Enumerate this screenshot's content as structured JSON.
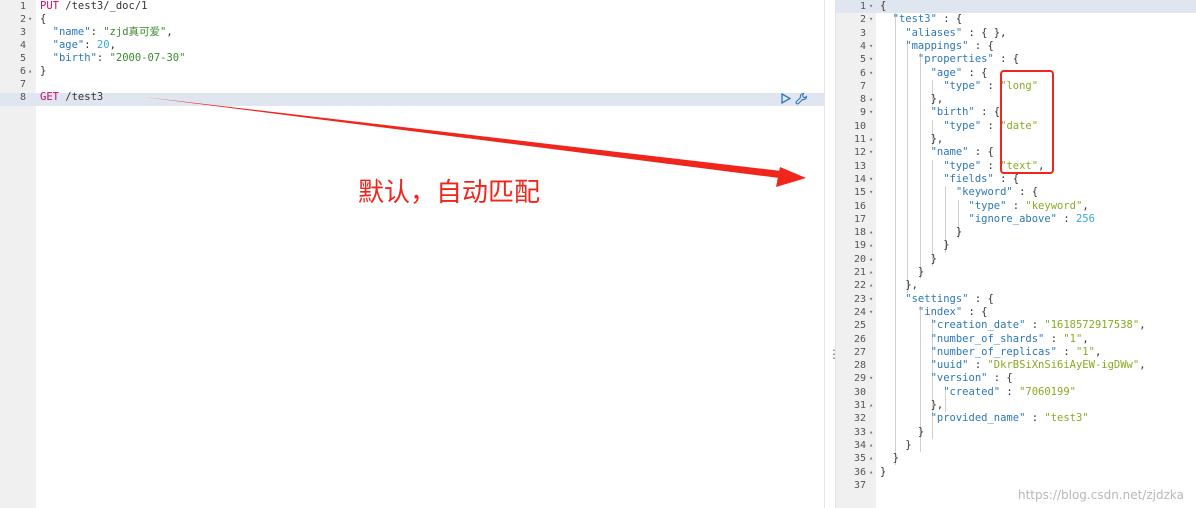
{
  "colors": {
    "method": "#c80a68",
    "key": "#2d77b6",
    "string": "#88aa22",
    "number": "#3da5d9",
    "annotation": "#f0251c",
    "active_line": "#e0e6ef",
    "gutter": "#f0f0f0"
  },
  "request_editor": {
    "lines": [
      {
        "n": "1",
        "fold": "",
        "tokens": [
          {
            "t": "PUT",
            "c": "method"
          },
          {
            "t": " /test3/_doc/1",
            "c": "url"
          }
        ]
      },
      {
        "n": "2",
        "fold": "▾",
        "tokens": [
          {
            "t": "{",
            "c": "punc"
          }
        ]
      },
      {
        "n": "3",
        "fold": "",
        "tokens": [
          {
            "t": "  \"name\"",
            "c": "key"
          },
          {
            "t": ": ",
            "c": "punc"
          },
          {
            "t": "\"zjd真可爱\"",
            "c": "strg"
          },
          {
            "t": ",",
            "c": "punc"
          }
        ]
      },
      {
        "n": "4",
        "fold": "",
        "tokens": [
          {
            "t": "  \"age\"",
            "c": "key"
          },
          {
            "t": ": ",
            "c": "punc"
          },
          {
            "t": "20",
            "c": "num"
          },
          {
            "t": ",",
            "c": "punc"
          }
        ]
      },
      {
        "n": "5",
        "fold": "",
        "tokens": [
          {
            "t": "  \"birth\"",
            "c": "key"
          },
          {
            "t": ": ",
            "c": "punc"
          },
          {
            "t": "\"2000-07-30\"",
            "c": "strg"
          }
        ]
      },
      {
        "n": "6",
        "fold": "▴",
        "tokens": [
          {
            "t": "}",
            "c": "punc"
          }
        ]
      },
      {
        "n": "7",
        "fold": "",
        "tokens": []
      },
      {
        "n": "8",
        "fold": "",
        "tokens": [
          {
            "t": "GET",
            "c": "method"
          },
          {
            "t": " /test3",
            "c": "url"
          }
        ]
      }
    ],
    "run_icon": "play-icon",
    "settings_icon": "wrench-icon"
  },
  "response_viewer": {
    "lines": [
      {
        "n": "1",
        "fold": "▾",
        "tokens": [
          {
            "t": "{",
            "c": "punc"
          }
        ]
      },
      {
        "n": "2",
        "fold": "▾",
        "tokens": [
          {
            "t": "  \"test3\"",
            "c": "key"
          },
          {
            "t": " : {",
            "c": "punc"
          }
        ]
      },
      {
        "n": "3",
        "fold": "",
        "tokens": [
          {
            "t": "    \"aliases\"",
            "c": "key"
          },
          {
            "t": " : { },",
            "c": "punc"
          }
        ]
      },
      {
        "n": "4",
        "fold": "▾",
        "tokens": [
          {
            "t": "    \"mappings\"",
            "c": "key"
          },
          {
            "t": " : {",
            "c": "punc"
          }
        ]
      },
      {
        "n": "5",
        "fold": "▾",
        "tokens": [
          {
            "t": "      \"properties\"",
            "c": "key"
          },
          {
            "t": " : {",
            "c": "punc"
          }
        ]
      },
      {
        "n": "6",
        "fold": "▾",
        "tokens": [
          {
            "t": "        \"age\"",
            "c": "key"
          },
          {
            "t": " : {",
            "c": "punc"
          }
        ]
      },
      {
        "n": "7",
        "fold": "",
        "tokens": [
          {
            "t": "          \"type\"",
            "c": "key"
          },
          {
            "t": " : ",
            "c": "punc"
          },
          {
            "t": "\"long\"",
            "c": "str"
          }
        ]
      },
      {
        "n": "8",
        "fold": "▴",
        "tokens": [
          {
            "t": "        },",
            "c": "punc"
          }
        ]
      },
      {
        "n": "9",
        "fold": "▾",
        "tokens": [
          {
            "t": "        \"birth\"",
            "c": "key"
          },
          {
            "t": " : {",
            "c": "punc"
          }
        ]
      },
      {
        "n": "10",
        "fold": "",
        "tokens": [
          {
            "t": "          \"type\"",
            "c": "key"
          },
          {
            "t": " : ",
            "c": "punc"
          },
          {
            "t": "\"date\"",
            "c": "str"
          }
        ]
      },
      {
        "n": "11",
        "fold": "▴",
        "tokens": [
          {
            "t": "        },",
            "c": "punc"
          }
        ]
      },
      {
        "n": "12",
        "fold": "▾",
        "tokens": [
          {
            "t": "        \"name\"",
            "c": "key"
          },
          {
            "t": " : {",
            "c": "punc"
          }
        ]
      },
      {
        "n": "13",
        "fold": "",
        "tokens": [
          {
            "t": "          \"type\"",
            "c": "key"
          },
          {
            "t": " : ",
            "c": "punc"
          },
          {
            "t": "\"text\"",
            "c": "str"
          },
          {
            "t": ",",
            "c": "punc"
          }
        ]
      },
      {
        "n": "14",
        "fold": "▾",
        "tokens": [
          {
            "t": "          \"fields\"",
            "c": "key"
          },
          {
            "t": " : {",
            "c": "punc"
          }
        ]
      },
      {
        "n": "15",
        "fold": "▾",
        "tokens": [
          {
            "t": "            \"keyword\"",
            "c": "key"
          },
          {
            "t": " : {",
            "c": "punc"
          }
        ]
      },
      {
        "n": "16",
        "fold": "",
        "tokens": [
          {
            "t": "              \"type\"",
            "c": "key"
          },
          {
            "t": " : ",
            "c": "punc"
          },
          {
            "t": "\"keyword\"",
            "c": "str"
          },
          {
            "t": ",",
            "c": "punc"
          }
        ]
      },
      {
        "n": "17",
        "fold": "",
        "tokens": [
          {
            "t": "              \"ignore_above\"",
            "c": "key"
          },
          {
            "t": " : ",
            "c": "punc"
          },
          {
            "t": "256",
            "c": "num"
          }
        ]
      },
      {
        "n": "18",
        "fold": "▴",
        "tokens": [
          {
            "t": "            }",
            "c": "punc"
          }
        ]
      },
      {
        "n": "19",
        "fold": "▴",
        "tokens": [
          {
            "t": "          }",
            "c": "punc"
          }
        ]
      },
      {
        "n": "20",
        "fold": "▴",
        "tokens": [
          {
            "t": "        }",
            "c": "punc"
          }
        ]
      },
      {
        "n": "21",
        "fold": "▴",
        "tokens": [
          {
            "t": "      }",
            "c": "punc"
          }
        ]
      },
      {
        "n": "22",
        "fold": "▴",
        "tokens": [
          {
            "t": "    },",
            "c": "punc"
          }
        ]
      },
      {
        "n": "23",
        "fold": "▾",
        "tokens": [
          {
            "t": "    \"settings\"",
            "c": "key"
          },
          {
            "t": " : {",
            "c": "punc"
          }
        ]
      },
      {
        "n": "24",
        "fold": "▾",
        "tokens": [
          {
            "t": "      \"index\"",
            "c": "key"
          },
          {
            "t": " : {",
            "c": "punc"
          }
        ]
      },
      {
        "n": "25",
        "fold": "",
        "tokens": [
          {
            "t": "        \"creation_date\"",
            "c": "key"
          },
          {
            "t": " : ",
            "c": "punc"
          },
          {
            "t": "\"1618572917538\"",
            "c": "str"
          },
          {
            "t": ",",
            "c": "punc"
          }
        ]
      },
      {
        "n": "26",
        "fold": "",
        "tokens": [
          {
            "t": "        \"number_of_shards\"",
            "c": "key"
          },
          {
            "t": " : ",
            "c": "punc"
          },
          {
            "t": "\"1\"",
            "c": "str"
          },
          {
            "t": ",",
            "c": "punc"
          }
        ]
      },
      {
        "n": "27",
        "fold": "",
        "tokens": [
          {
            "t": "        \"number_of_replicas\"",
            "c": "key"
          },
          {
            "t": " : ",
            "c": "punc"
          },
          {
            "t": "\"1\"",
            "c": "str"
          },
          {
            "t": ",",
            "c": "punc"
          }
        ]
      },
      {
        "n": "28",
        "fold": "",
        "tokens": [
          {
            "t": "        \"uuid\"",
            "c": "key"
          },
          {
            "t": " : ",
            "c": "punc"
          },
          {
            "t": "\"DkrBSiXnSi6iAyEW-igDWw\"",
            "c": "str"
          },
          {
            "t": ",",
            "c": "punc"
          }
        ]
      },
      {
        "n": "29",
        "fold": "▾",
        "tokens": [
          {
            "t": "        \"version\"",
            "c": "key"
          },
          {
            "t": " : {",
            "c": "punc"
          }
        ]
      },
      {
        "n": "30",
        "fold": "",
        "tokens": [
          {
            "t": "          \"created\"",
            "c": "key"
          },
          {
            "t": " : ",
            "c": "punc"
          },
          {
            "t": "\"7060199\"",
            "c": "str"
          }
        ]
      },
      {
        "n": "31",
        "fold": "▴",
        "tokens": [
          {
            "t": "        },",
            "c": "punc"
          }
        ]
      },
      {
        "n": "32",
        "fold": "",
        "tokens": [
          {
            "t": "        \"provided_name\"",
            "c": "key"
          },
          {
            "t": " : ",
            "c": "punc"
          },
          {
            "t": "\"test3\"",
            "c": "str"
          }
        ]
      },
      {
        "n": "33",
        "fold": "▴",
        "tokens": [
          {
            "t": "      }",
            "c": "punc"
          }
        ]
      },
      {
        "n": "34",
        "fold": "▴",
        "tokens": [
          {
            "t": "    }",
            "c": "punc"
          }
        ]
      },
      {
        "n": "35",
        "fold": "▴",
        "tokens": [
          {
            "t": "  }",
            "c": "punc"
          }
        ]
      },
      {
        "n": "36",
        "fold": "▴",
        "tokens": [
          {
            "t": "}",
            "c": "punc"
          }
        ]
      },
      {
        "n": "37",
        "fold": "",
        "tokens": []
      }
    ]
  },
  "annotation": {
    "text": "默认，自动匹配"
  },
  "watermark": "https://blog.csdn.net/zjdzka",
  "divider_handle": "⋮"
}
